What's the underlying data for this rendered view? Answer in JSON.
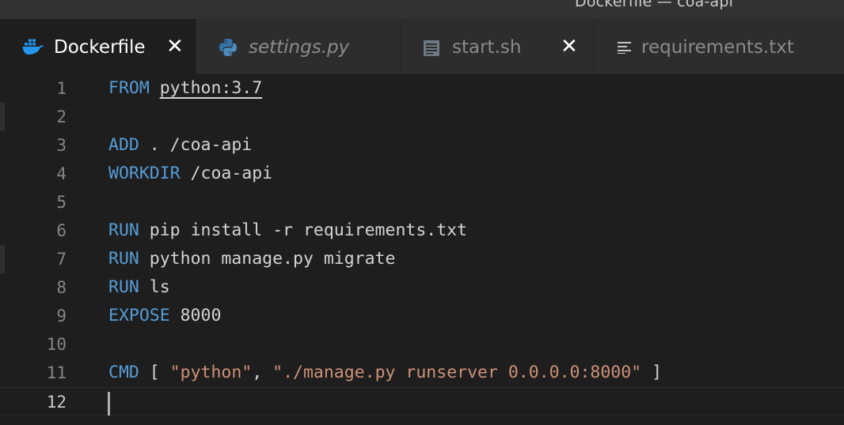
{
  "window": {
    "title": "Dockerfile — coa-api"
  },
  "tabs": [
    {
      "label": "Dockerfile",
      "icon": "docker-icon",
      "active": true,
      "italic": false,
      "close_visible": true
    },
    {
      "label": "settings.py",
      "icon": "python-icon",
      "active": false,
      "italic": true,
      "close_visible": false
    },
    {
      "label": "start.sh",
      "icon": "shell-file-icon",
      "active": false,
      "italic": false,
      "close_visible": true
    },
    {
      "label": "requirements.txt",
      "icon": "text-lines-icon",
      "active": false,
      "italic": false,
      "close_visible": false
    }
  ],
  "close_glyph": "✕",
  "colors": {
    "keyword": "#569cd6",
    "string": "#ce9178",
    "text": "#d4d4d4",
    "editor_background": "#1e1e1e",
    "tab_background": "#2d2d2d"
  },
  "editor": {
    "cursor_line": 12,
    "lines": [
      {
        "number": "1",
        "tokens": [
          {
            "t": "FROM",
            "c": "kw"
          },
          {
            "t": " "
          },
          {
            "t": "python:3.7",
            "c": "img-ref"
          }
        ]
      },
      {
        "number": "2",
        "tokens": []
      },
      {
        "number": "3",
        "tokens": [
          {
            "t": "ADD",
            "c": "kw"
          },
          {
            "t": " . /coa-api"
          }
        ]
      },
      {
        "number": "4",
        "tokens": [
          {
            "t": "WORKDIR",
            "c": "kw"
          },
          {
            "t": " /coa-api"
          }
        ]
      },
      {
        "number": "5",
        "tokens": []
      },
      {
        "number": "6",
        "tokens": [
          {
            "t": "RUN",
            "c": "kw"
          },
          {
            "t": " pip install -r requirements.txt"
          }
        ]
      },
      {
        "number": "7",
        "tokens": [
          {
            "t": "RUN",
            "c": "kw"
          },
          {
            "t": " python manage.py migrate"
          }
        ]
      },
      {
        "number": "8",
        "tokens": [
          {
            "t": "RUN",
            "c": "kw"
          },
          {
            "t": " ls"
          }
        ]
      },
      {
        "number": "9",
        "tokens": [
          {
            "t": "EXPOSE",
            "c": "kw"
          },
          {
            "t": " 8000"
          }
        ]
      },
      {
        "number": "10",
        "tokens": []
      },
      {
        "number": "11",
        "tokens": [
          {
            "t": "CMD",
            "c": "kw"
          },
          {
            "t": " [ "
          },
          {
            "t": "\"python\"",
            "c": "str"
          },
          {
            "t": ", "
          },
          {
            "t": "\"./manage.py runserver 0.0.0.0:8000\"",
            "c": "str"
          },
          {
            "t": " ]"
          }
        ]
      },
      {
        "number": "12",
        "tokens": []
      }
    ]
  }
}
